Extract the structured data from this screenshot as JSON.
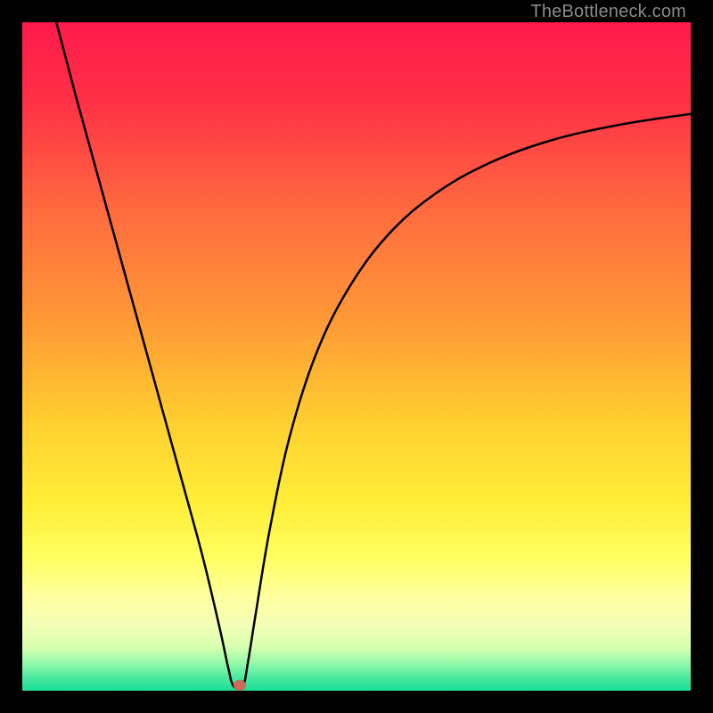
{
  "watermark": {
    "text": "TheBottleneck.com"
  },
  "marker": {
    "color": "#cd6a5a",
    "x_percent": 32.5,
    "y_percent": 99.2
  },
  "chart_data": {
    "type": "line",
    "title": "",
    "xlabel": "",
    "ylabel": "",
    "xlim": [
      0,
      100
    ],
    "ylim": [
      0,
      100
    ],
    "grid": false,
    "legend": false,
    "background_gradient_stops": [
      {
        "pos": 0.0,
        "color": "#ff1a4b"
      },
      {
        "pos": 0.12,
        "color": "#ff3146"
      },
      {
        "pos": 0.28,
        "color": "#ff6a3f"
      },
      {
        "pos": 0.45,
        "color": "#ff9a36"
      },
      {
        "pos": 0.6,
        "color": "#ffcf2f"
      },
      {
        "pos": 0.72,
        "color": "#ffee38"
      },
      {
        "pos": 0.8,
        "color": "#ffff60"
      },
      {
        "pos": 0.86,
        "color": "#ffffa0"
      },
      {
        "pos": 0.9,
        "color": "#f3ffb6"
      },
      {
        "pos": 0.935,
        "color": "#d8ffb0"
      },
      {
        "pos": 0.96,
        "color": "#90f8a8"
      },
      {
        "pos": 0.98,
        "color": "#4de9a0"
      },
      {
        "pos": 1.0,
        "color": "#18df94"
      }
    ],
    "series": [
      {
        "name": "bottleneck-curve",
        "color": "#000000",
        "stroke_width": 2.5,
        "x": [
          5.1,
          8,
          12,
          16,
          20,
          24,
          27,
          29.5,
          30.8,
          31.6,
          33.0,
          33.8,
          35,
          37,
          40,
          44,
          49,
          55,
          62,
          70,
          79,
          89,
          100
        ],
        "y": [
          100,
          89,
          74.5,
          60,
          45.5,
          31,
          20,
          9.5,
          3.5,
          0.7,
          0.7,
          4.5,
          12,
          24,
          38,
          50.5,
          60.5,
          68.5,
          74.5,
          79,
          82.3,
          84.6,
          86.3
        ]
      }
    ],
    "marker_point": {
      "x": 32.5,
      "y": 0.8,
      "color": "#cd6a5a"
    }
  }
}
